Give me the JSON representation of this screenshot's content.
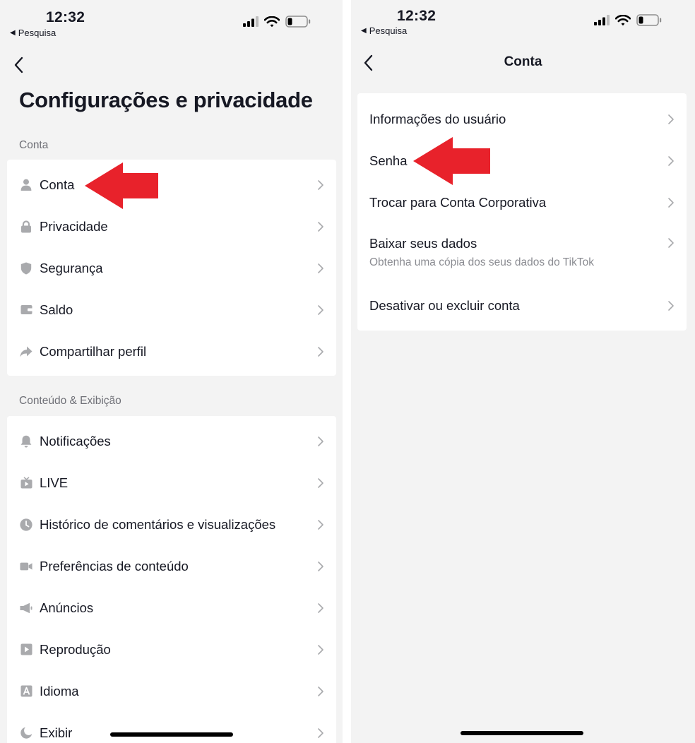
{
  "left_screen": {
    "status": {
      "time": "12:32",
      "back_app": "Pesquisa"
    },
    "title": "Configurações e privacidade",
    "section_account": "Conta",
    "account_items": [
      {
        "label": "Conta",
        "icon": "person-icon"
      },
      {
        "label": "Privacidade",
        "icon": "lock-icon"
      },
      {
        "label": "Segurança",
        "icon": "shield-icon"
      },
      {
        "label": "Saldo",
        "icon": "wallet-icon"
      },
      {
        "label": "Compartilhar perfil",
        "icon": "share-icon"
      }
    ],
    "section_content": "Conteúdo & Exibição",
    "content_items": [
      {
        "label": "Notificações",
        "icon": "bell-icon"
      },
      {
        "label": "LIVE",
        "icon": "live-tv-icon"
      },
      {
        "label": "Histórico de comentários e visualizações",
        "icon": "clock-icon"
      },
      {
        "label": "Preferências de conteúdo",
        "icon": "video-camera-icon"
      },
      {
        "label": "Anúncios",
        "icon": "megaphone-icon"
      },
      {
        "label": "Reprodução",
        "icon": "play-icon"
      },
      {
        "label": "Idioma",
        "icon": "language-icon"
      },
      {
        "label": "Exibir",
        "icon": "moon-icon"
      }
    ]
  },
  "right_screen": {
    "status": {
      "time": "12:32",
      "back_app": "Pesquisa"
    },
    "title": "Conta",
    "items": [
      {
        "label": "Informações do usuário"
      },
      {
        "label": "Senha"
      },
      {
        "label": "Trocar para Conta Corporativa"
      },
      {
        "label": "Baixar seus dados",
        "subtitle": "Obtenha uma cópia dos seus dados do TikTok"
      },
      {
        "label": "Desativar ou excluir conta"
      }
    ]
  },
  "colors": {
    "background": "#f3f3f3",
    "card": "#ffffff",
    "text": "#161823",
    "secondary_text": "#6f7077",
    "icon": "#a9aaad",
    "annotation_arrow": "#e8222b"
  }
}
